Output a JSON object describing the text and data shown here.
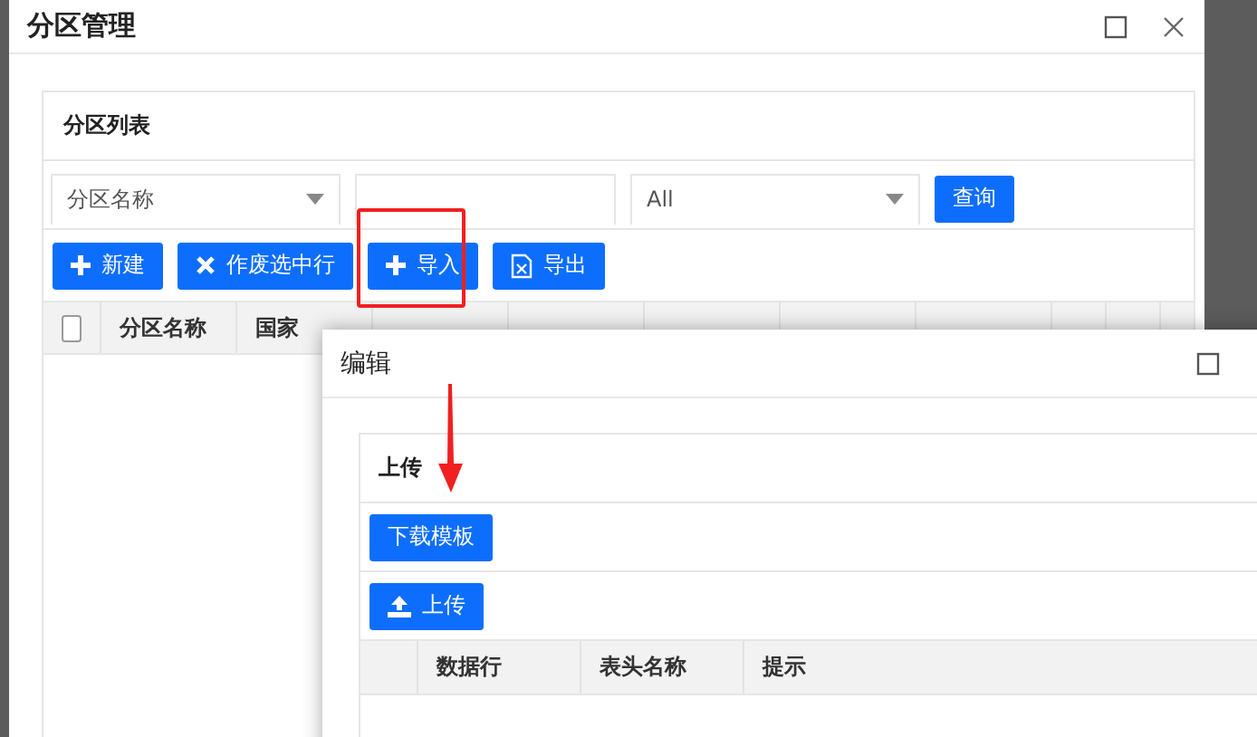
{
  "window": {
    "title": "分区管理"
  },
  "panel": {
    "title": "分区列表"
  },
  "filters": {
    "field_select": "分区名称",
    "status_select": "All",
    "query_button": "查询"
  },
  "toolbar": [
    {
      "label": "新建",
      "kind": "add"
    },
    {
      "label": "作废选中行",
      "kind": "void"
    },
    {
      "label": "导入",
      "kind": "add"
    },
    {
      "label": "导出",
      "kind": "export"
    }
  ],
  "table": {
    "select_all": {
      "checked": false
    },
    "columns": [
      "分区名称",
      "国家"
    ]
  },
  "dialog": {
    "title": "编辑",
    "section_title": "上传",
    "template_button": "下载模板",
    "upload_button": "上传",
    "columns": [
      "数据行",
      "表头名称",
      "提示"
    ]
  }
}
